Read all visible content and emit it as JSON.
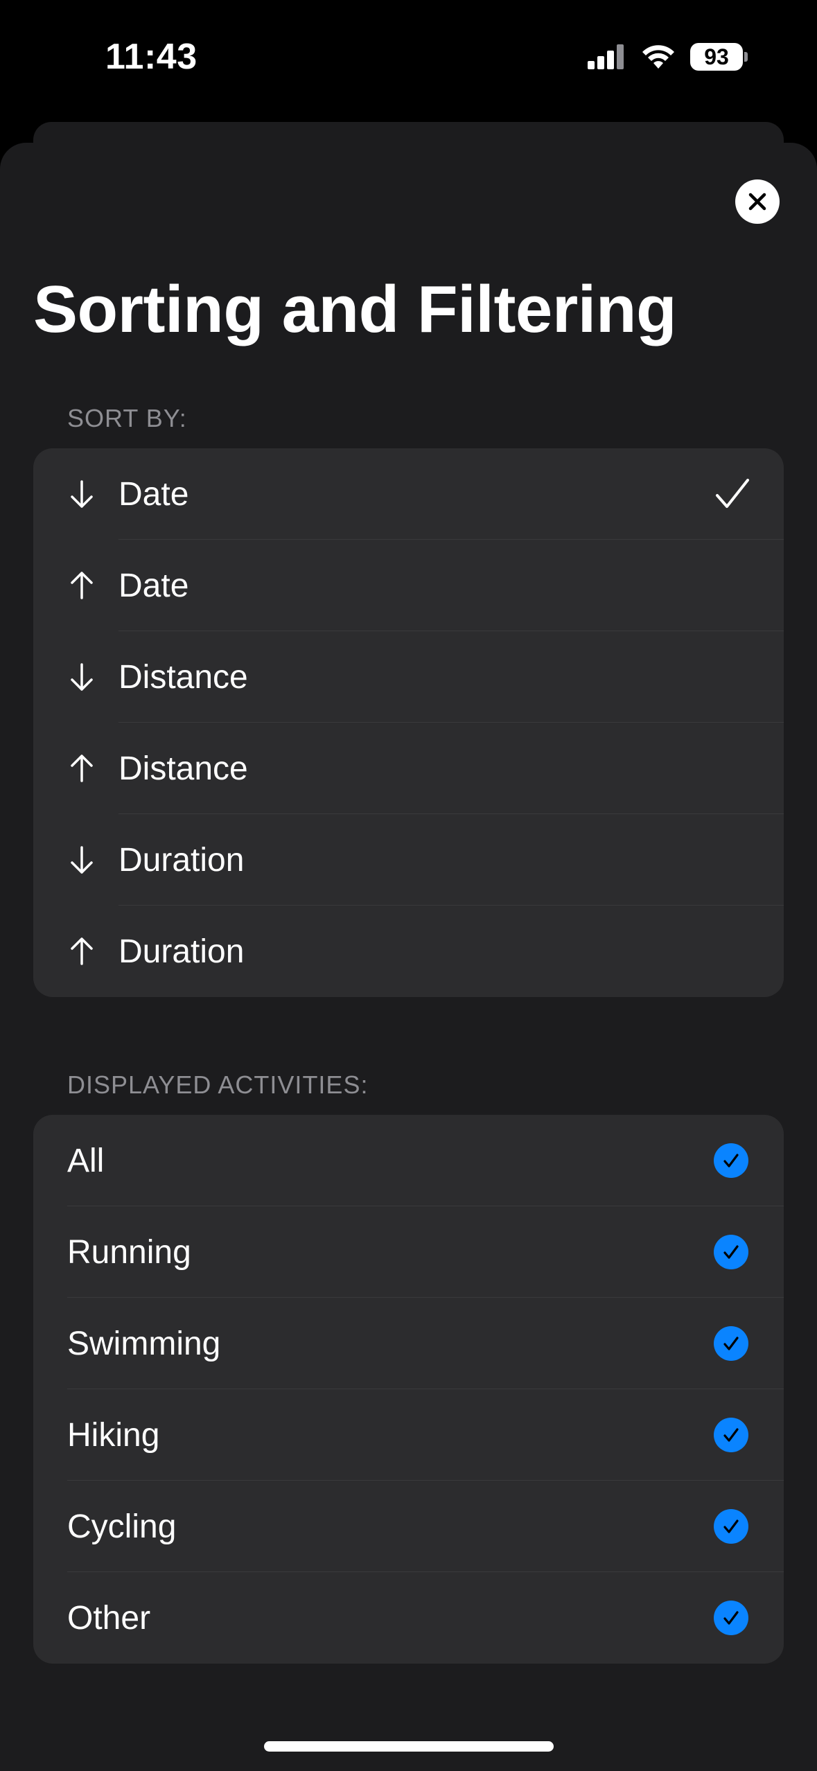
{
  "status_bar": {
    "time": "11:43",
    "battery": "93",
    "icons": [
      "cellular-signal-icon",
      "wifi-icon",
      "battery-icon"
    ]
  },
  "sheet": {
    "title": "Sorting and Filtering",
    "close_icon": "close-icon"
  },
  "sort": {
    "header": "SORT BY:",
    "items": [
      {
        "direction": "down",
        "label": "Date",
        "selected": true
      },
      {
        "direction": "up",
        "label": "Date",
        "selected": false
      },
      {
        "direction": "down",
        "label": "Distance",
        "selected": false
      },
      {
        "direction": "up",
        "label": "Distance",
        "selected": false
      },
      {
        "direction": "down",
        "label": "Duration",
        "selected": false
      },
      {
        "direction": "up",
        "label": "Duration",
        "selected": false
      }
    ]
  },
  "activities": {
    "header": "DISPLAYED ACTIVITIES:",
    "items": [
      {
        "label": "All",
        "checked": true
      },
      {
        "label": "Running",
        "checked": true
      },
      {
        "label": "Swimming",
        "checked": true
      },
      {
        "label": "Hiking",
        "checked": true
      },
      {
        "label": "Cycling",
        "checked": true
      },
      {
        "label": "Other",
        "checked": true
      }
    ]
  },
  "colors": {
    "background": "#000000",
    "sheet": "#1c1c1e",
    "group": "#2c2c2e",
    "accent": "#0a84ff",
    "secondary_text": "#8e8e93"
  }
}
